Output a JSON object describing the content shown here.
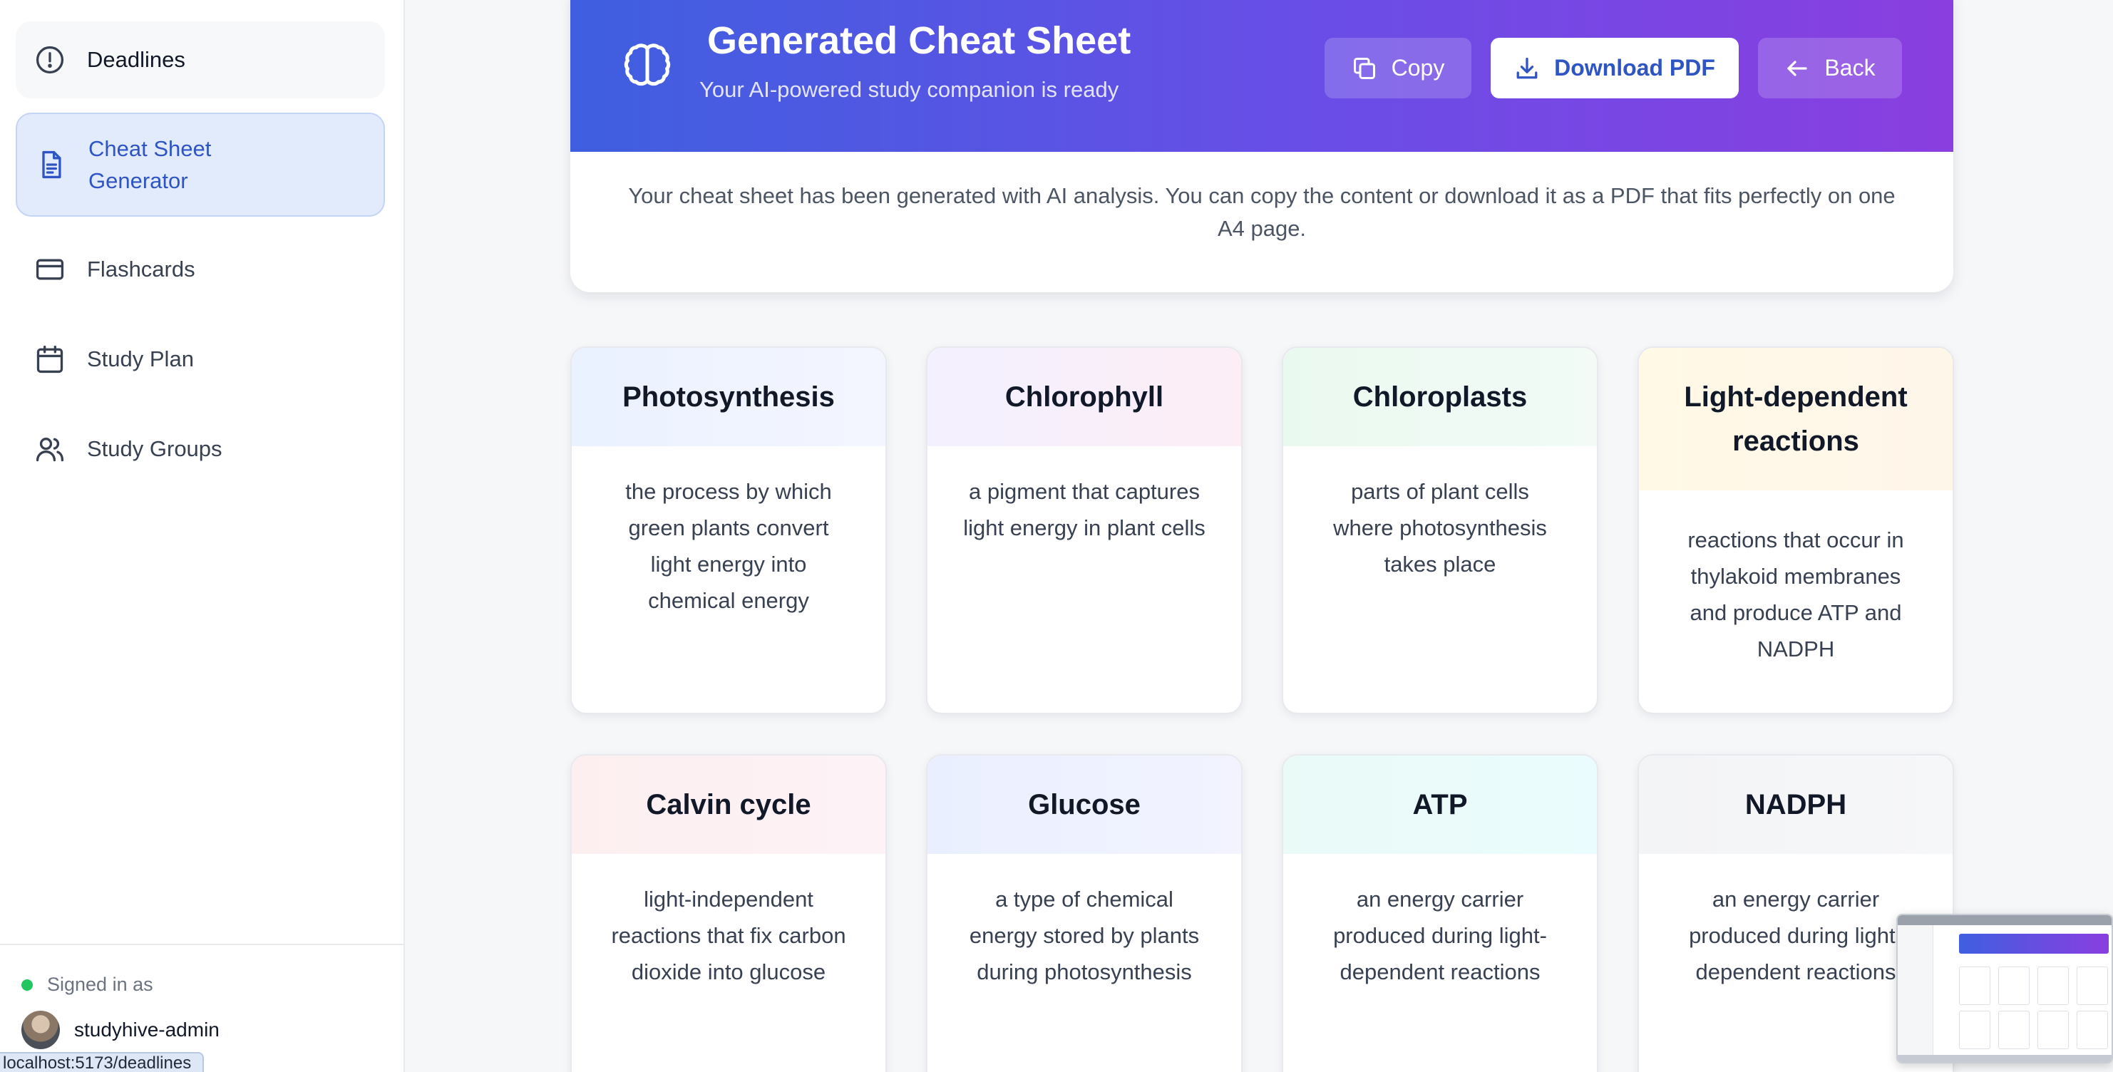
{
  "sidebar": {
    "items": [
      {
        "label": "Deadlines",
        "icon": "alert-circle-icon"
      },
      {
        "label": "Cheat Sheet\nGenerator",
        "icon": "document-icon",
        "active": true
      },
      {
        "label": "Flashcards",
        "icon": "card-icon"
      },
      {
        "label": "Study Plan",
        "icon": "calendar-icon"
      },
      {
        "label": "Study Groups",
        "icon": "users-icon"
      }
    ],
    "footer": {
      "signed_in_label": "Signed in as",
      "username": "studyhive-admin"
    },
    "status_url": "localhost:5173/deadlines"
  },
  "header": {
    "title": "Generated Cheat Sheet",
    "subtitle": "Your AI-powered study companion is ready",
    "icon": "brain-icon",
    "buttons": {
      "copy": "Copy",
      "download": "Download PDF",
      "back": "Back"
    },
    "description": "Your cheat sheet has been generated with AI analysis. You can copy the content or download it as a PDF that fits perfectly on one A4 page."
  },
  "cards": [
    {
      "term": "Photosynthesis",
      "definition": "the process by which green plants convert light energy into chemical energy"
    },
    {
      "term": "Chlorophyll",
      "definition": "a pigment that captures light energy in plant cells"
    },
    {
      "term": "Chloroplasts",
      "definition": "parts of plant cells where photosynthesis takes place"
    },
    {
      "term": "Light-dependent reactions",
      "definition": "reactions that occur in thylakoid membranes and produce ATP and NADPH"
    },
    {
      "term": "Calvin cycle",
      "definition": "light-independent reactions that fix carbon dioxide into glucose"
    },
    {
      "term": "Glucose",
      "definition": "a type of chemical energy stored by plants during photosynthesis"
    },
    {
      "term": "ATP",
      "definition": "an energy carrier produced during light-dependent reactions"
    },
    {
      "term": "NADPH",
      "definition": "an energy carrier produced during light-dependent reactions"
    }
  ],
  "colors": {
    "accent": "#2f55c4",
    "header_gradient_start": "#3f5fe0",
    "header_gradient_end": "#8a3ee0",
    "online": "#22c55e"
  }
}
